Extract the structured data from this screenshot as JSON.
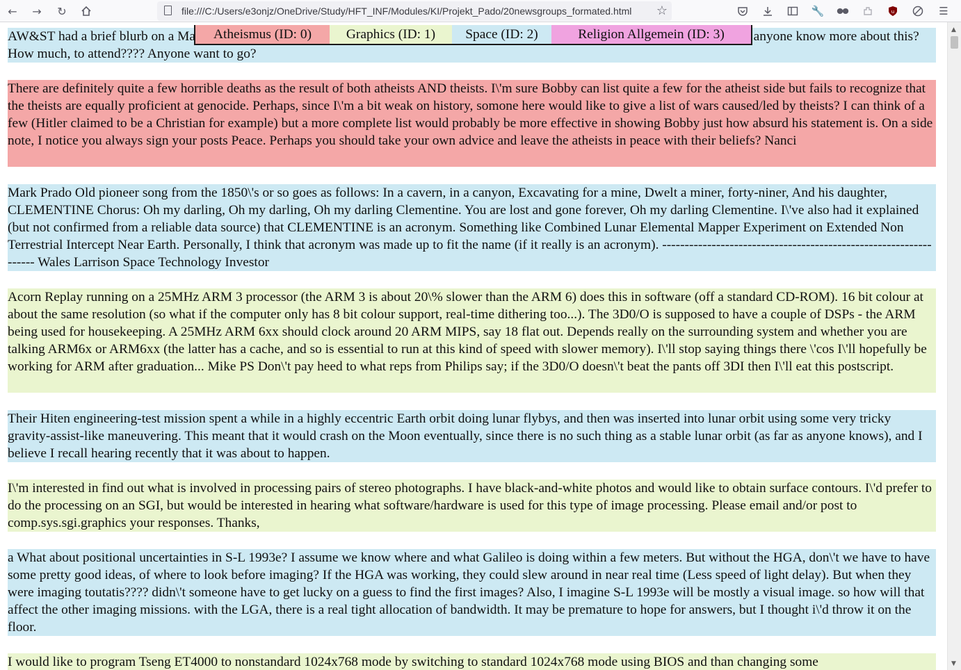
{
  "browser": {
    "url": "file:///C:/Users/e3onjz/OneDrive/Study/HFT_INF/Modules/KI/Projekt_Pado/20newsgroups_formated.html",
    "nav_icons": [
      "back-arrow-icon",
      "forward-arrow-icon",
      "reload-icon",
      "home-icon"
    ],
    "toolbar_icons": [
      "pocket-icon",
      "download-icon",
      "sidebar-icon",
      "wrench-icon",
      "mask-icon",
      "extension-icon",
      "ublock-icon",
      "disable-icon",
      "menu-icon"
    ]
  },
  "legend": [
    {
      "label": "Atheismus (ID: 0)",
      "color": "#f4a7a7"
    },
    {
      "label": "Graphics (ID: 1)",
      "color": "#eaf5cf"
    },
    {
      "label": "Space (ID: 2)",
      "color": "#cde9f3"
    },
    {
      "label": "Religion Allgemein (ID: 3)",
      "color": "#f0a3e0"
    }
  ],
  "posts": [
    {
      "category": 2,
      "text": "AW&ST had a brief blurb on a Manned Lunar Exploration confernce May 7th at Crystal City Virginia, under the auspices of AIAA. Does anyone know more about this? How much, to attend???? Anyone want to go?"
    },
    {
      "category": 0,
      "text": "There are definitely quite a few horrible deaths as the result of both atheists AND theists. I\\'m sure Bobby can list quite a few for the atheist side but fails to recognize that the theists are equally proficient at genocide. Perhaps, since I\\'m a bit weak on history, somone here would like to give a list of wars caused/led by theists? I can think of a few (Hitler claimed to be a Christian for example) but a more complete list would probably be more effective in showing Bobby just how absurd his statement is. On a side note, I notice you always sign your posts Peace. Perhaps you should take your own advice and leave the atheists in peace with their beliefs? Nanci"
    },
    {
      "category": 2,
      "text": "Mark Prado Old pioneer song from the 1850\\'s or so goes as follows: In a cavern, in a canyon, Excavating for a mine, Dwelt a miner, forty-niner, And his daughter, CLEMENTINE Chorus: Oh my darling, Oh my darling, Oh my darling Clementine. You are lost and gone forever, Oh my darling Clementine. I\\'ve also had it explained (but not confirmed from a reliable data source) that CLEMENTINE is an acronym. Something like Combined Lunar Elemental Mapper Experiment on Extended Non Terrestrial Intercept Near Earth. Personally, I think that acronym was made up to fit the name (if it really is an acronym). ------------------------------------------------------------------ Wales Larrison Space Technology Investor"
    },
    {
      "category": 1,
      "text": "Acorn Replay running on a 25MHz ARM 3 processor (the ARM 3 is about 20\\% slower than the ARM 6) does this in software (off a standard CD-ROM). 16 bit colour at about the same resolution (so what if the computer only has 8 bit colour support, real-time dithering too...). The 3D0/O is supposed to have a couple of DSPs - the ARM being used for housekeeping. A 25MHz ARM 6xx should clock around 20 ARM MIPS, say 18 flat out. Depends really on the surrounding system and whether you are talking ARM6x or ARM6xx (the latter has a cache, and so is essential to run at this kind of speed with slower memory). I\\'ll stop saying things there \\'cos I\\'ll hopefully be working for ARM after graduation... Mike PS Don\\'t pay heed to what reps from Philips say; if the 3D0/O doesn\\'t beat the pants off 3DI then I\\'ll eat this postscript."
    },
    {
      "category": 2,
      "text": "Their Hiten engineering-test mission spent a while in a highly eccentric Earth orbit doing lunar flybys, and then was inserted into lunar orbit using some very tricky gravity-assist-like maneuvering. This meant that it would crash on the Moon eventually, since there is no such thing as a stable lunar orbit (as far as anyone knows), and I believe I recall hearing recently that it was about to happen."
    },
    {
      "category": 1,
      "text": "I\\'m interested in find out what is involved in processing pairs of stereo photographs. I have black-and-white photos and would like to obtain surface contours. I\\'d prefer to do the processing on an SGI, but would be interested in hearing what software/hardware is used for this type of image processing. Please email and/or post to comp.sys.sgi.graphics your responses. Thanks,"
    },
    {
      "category": 2,
      "text": "a What about positional uncertainties in S-L 1993e? I assume we know where and what Galileo is doing within a few meters. But without the HGA, don\\'t we have to have some pretty good ideas, of where to look before imaging? If the HGA was working, they could slew around in near real time (Less speed of light delay). But when they were imaging toutatis???? didn\\'t someone have to get lucky on a guess to find the first images? Also, I imagine S-L 1993e will be mostly a visual image. so how will that affect the other imaging missions. with the LGA, there is a real tight allocation of bandwidth. It may be premature to hope for answers, but I thought i\\'d throw it on the floor."
    },
    {
      "category": 1,
      "text": "I would like to program Tseng ET4000 to nonstandard 1024x768 mode by switching to standard 1024x768 mode using BIOS and than changing some"
    }
  ]
}
